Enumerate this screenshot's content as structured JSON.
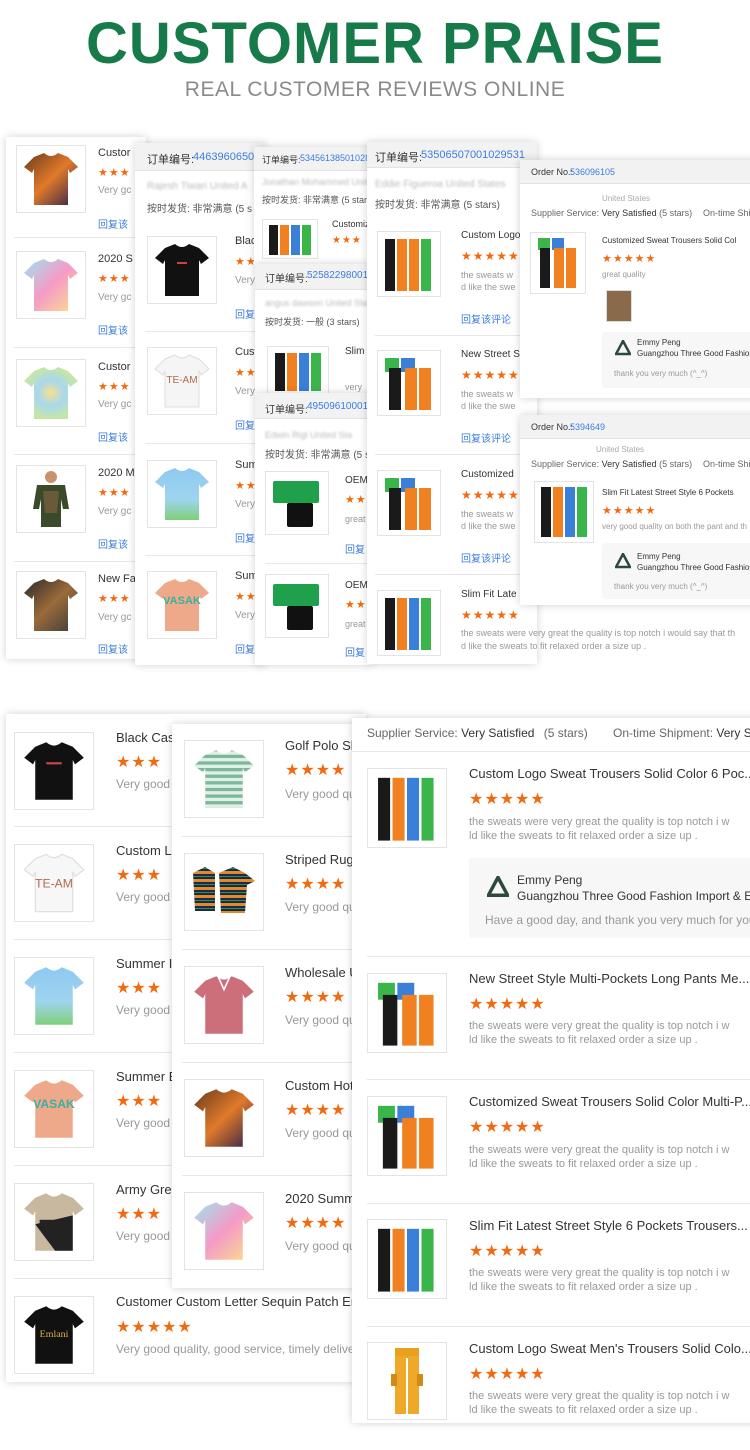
{
  "header": {
    "title": "CUSTOMER PRAISE",
    "subtitle": "REAL CUSTOMER REVIEWS ONLINE"
  },
  "top": {
    "panel1": {
      "items": [
        {
          "title": "Custor",
          "stars": "★★★",
          "text": "Very gc",
          "reply": "回复该"
        },
        {
          "title": "2020 S",
          "stars": "★★★",
          "text": "Very gc",
          "reply": "回复该"
        },
        {
          "title": "Custor",
          "stars": "★★★",
          "text": "Very gc",
          "reply": "回复该"
        },
        {
          "title": "2020 M",
          "stars": "★★★",
          "text": "Very gc",
          "reply": "回复该"
        },
        {
          "title": "New Fa",
          "stars": "★★★",
          "text": "Very gc",
          "reply": "回复该"
        }
      ]
    },
    "panel2": {
      "order_label": "订单编号:",
      "order_no": "44639606501",
      "buyer": "Rajesh Tiwari United A",
      "ship": "按时发货: 非常满意 (5 s",
      "items": [
        {
          "title": "Blac",
          "stars": "★★",
          "text": "Very",
          "reply": "回复"
        },
        {
          "title": "Cust",
          "stars": "★★",
          "text": "Very",
          "reply": "回复"
        },
        {
          "title": "Sum",
          "stars": "★★",
          "text": "Very",
          "reply": "回复"
        },
        {
          "title": "Sum",
          "stars": "★★",
          "text": "Very",
          "reply": "回复"
        }
      ]
    },
    "panel3": {
      "order_label": "订单编号:",
      "order_no": "534561385010285",
      "buyer": "Jonathan Mohammed United Sta",
      "ship": "按时发货: 非常满意 (5 stars)",
      "item_title": "Customiz",
      "stars": "★★★"
    },
    "panel4": {
      "order_label": "订单编号:",
      "order_no": "525822980010",
      "buyer": "angus dawson United Sta",
      "ship": "按时发货: 一般 (3 stars)",
      "item_title": "Slim",
      "text": "very"
    },
    "panel5": {
      "order_label": "订单编号:",
      "order_no": "495096100010",
      "buyer": "Edwin Rigl United Sta",
      "ship": "按时发货: 非常满意 (5 stars)",
      "items": [
        {
          "title": "OEM",
          "stars": "★★",
          "text": "great",
          "reply": "回复"
        },
        {
          "title": "OEM",
          "stars": "★★",
          "text": "great",
          "reply": "回复"
        }
      ]
    },
    "panel6": {
      "order_label": "订单编号:",
      "order_no": "53506507001029531",
      "buyer": "Eddie Figueroa United States",
      "ship": "按时发货: 非常满意 (5 stars)",
      "items": [
        {
          "title": "Custom Logo",
          "stars": "★★★★★",
          "text1": "the sweats w",
          "text2": "d like the swe",
          "reply": "回复该评论"
        },
        {
          "title": "New Street S",
          "stars": "★★★★★",
          "text1": "the sweats w",
          "text2": "d like the swe",
          "reply": "回复该评论"
        },
        {
          "title": "Customized",
          "stars": "★★★★★",
          "text1": "the sweats w",
          "text2": "d like the swe",
          "reply": "回复该评论"
        },
        {
          "title": "Slim Fit Late",
          "stars": "★★★★★",
          "text1": "the sweats were very great the quality is top notch i would say that th",
          "text2": "d like the sweats to fit relaxed order a size up .",
          "reply": ""
        }
      ]
    },
    "panel7": {
      "order_label": "Order No.:",
      "order_no": "536096105",
      "country": "United States",
      "service_label": "Supplier Service:",
      "service_value": "Very Satisfied",
      "service_stars": "(5 stars)",
      "shipment": "On-time Ship",
      "item_title": "Customized Sweat Trousers Solid Col",
      "stars": "★★★★★",
      "review": "great quality",
      "reply_name": "Emmy Peng",
      "reply_company": "Guangzhou Three Good Fashion",
      "reply_text": "thank you very much (^_^)"
    },
    "panel8": {
      "order_label": "Order No.:",
      "order_no": "5394649",
      "country": "United States",
      "service_label": "Supplier Service:",
      "service_value": "Very Satisfied",
      "service_stars": "(5 stars)",
      "shipment": "On-time Ship",
      "item_title": "Slim Fit Latest Street Style 6 Pockets",
      "stars": "★★★★★",
      "review": "very good quality on both the pant and th",
      "reply_name": "Emmy Peng",
      "reply_company": "Guangzhou Three Good Fashion",
      "reply_text": "thank you very much (^_^)"
    }
  },
  "bottom": {
    "left": {
      "items": [
        {
          "title": "Black Cas",
          "stars": "★★★",
          "text": "Very good"
        },
        {
          "title": "Custom L",
          "stars": "★★★",
          "text": "Very good"
        },
        {
          "title": "Summer I",
          "stars": "★★★",
          "text": "Very good"
        },
        {
          "title": "Summer E",
          "stars": "★★★",
          "text": "Very good"
        },
        {
          "title": "Army Gree",
          "stars": "★★★",
          "text": "Very good"
        },
        {
          "title": "Customer Custom Letter Sequin Patch Em",
          "stars": "★★★★★",
          "text": "Very good quality, good service, timely delive"
        }
      ]
    },
    "middle": {
      "items": [
        {
          "title": "Golf Polo Sh",
          "stars": "★★★★",
          "text": "Very good qu"
        },
        {
          "title": "Striped Rugb",
          "stars": "★★★★",
          "text": "Very good qu"
        },
        {
          "title": "Wholesale U",
          "stars": "★★★★",
          "text": "Very good qu"
        },
        {
          "title": "Custom Hot",
          "stars": "★★★★",
          "text": "Very good qu"
        },
        {
          "title": "2020 Summ",
          "stars": "★★★★",
          "text": "Very good qu"
        }
      ]
    },
    "right": {
      "service_label": "Supplier Service:",
      "service_value": "Very Satisfied",
      "service_stars": "(5 stars)",
      "shipment_label": "On-time Shipment:",
      "shipment_value": "Very Sa",
      "reply_name": "Emmy Peng",
      "reply_company": "Guangzhou Three Good Fashion Import & Exp",
      "reply_text": "Have a good day, and thank you very much for your",
      "items": [
        {
          "title": "Custom Logo Sweat Trousers Solid Color 6 Poc...",
          "stars": "★★★★★",
          "text1": "the sweats were very great the quality is top notch i w",
          "text2": "ld like the sweats to fit relaxed order a size up ."
        },
        {
          "title": "New Street Style Multi-Pockets Long Pants Me...",
          "stars": "★★★★★",
          "text1": "the sweats were very great the quality is top notch i w",
          "text2": "ld like the sweats to fit relaxed order a size up ."
        },
        {
          "title": "Customized Sweat Trousers Solid Color Multi-P...",
          "stars": "★★★★★",
          "text1": "the sweats were very great the quality is top notch i w",
          "text2": "ld like the sweats to fit relaxed order a size up ."
        },
        {
          "title": "Slim Fit Latest Street Style 6 Pockets Trousers...",
          "stars": "★★★★★",
          "text1": "the sweats were very great the quality is top notch i w",
          "text2": "ld like the sweats to fit relaxed order a size up ."
        },
        {
          "title": "Custom Logo Sweat Men's Trousers Solid Colo...",
          "stars": "★★★★★",
          "text1": "the sweats were very great the quality is top notch i w",
          "text2": "ld like the sweats to fit relaxed order a size up ."
        }
      ]
    }
  },
  "colors": {
    "title_green": "#167a49",
    "star_orange": "#f26a10",
    "link_blue": "#3b7de0"
  }
}
